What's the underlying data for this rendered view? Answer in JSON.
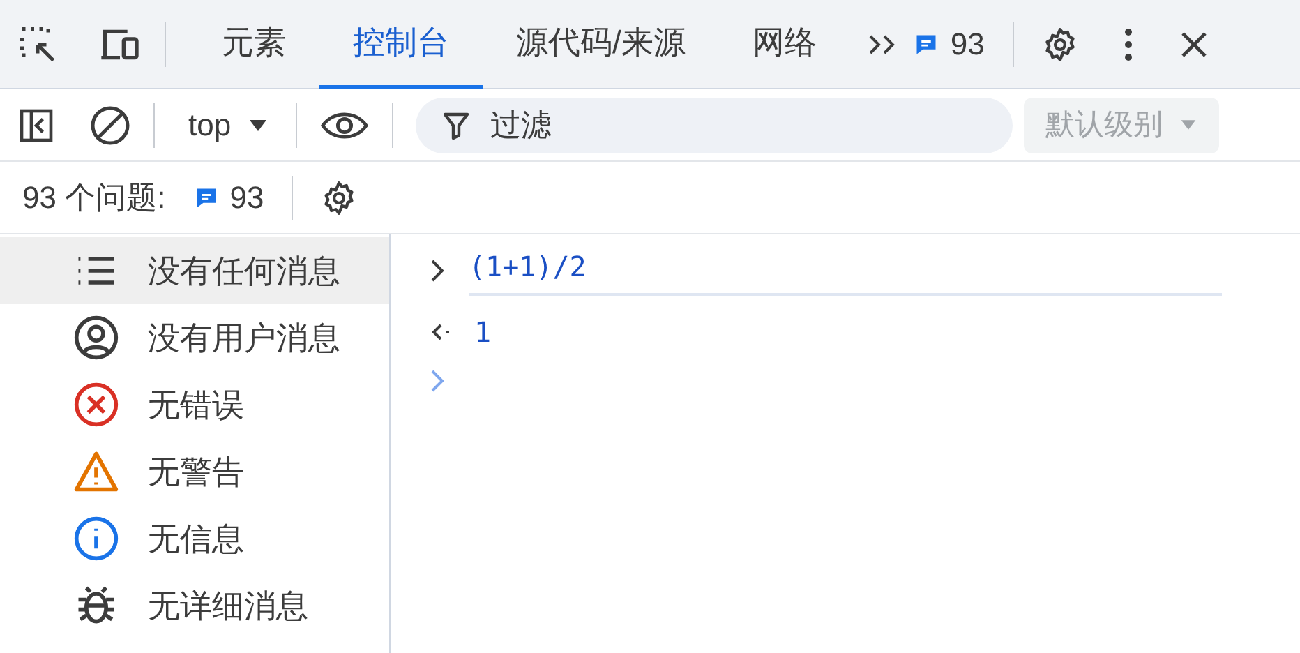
{
  "tabs": [
    {
      "label": "元素",
      "selected": false
    },
    {
      "label": "控制台",
      "selected": true
    },
    {
      "label": "源代码/来源",
      "selected": false
    },
    {
      "label": "网络",
      "selected": false
    }
  ],
  "issues_badge": "93",
  "toolbar": {
    "context": "top",
    "filter_placeholder": "过滤",
    "levels": "默认级别"
  },
  "issues_bar": {
    "label": "93 个问题:",
    "count": "93"
  },
  "sidebar": {
    "items": [
      {
        "label": "没有任何消息",
        "kind": "list",
        "selected": true
      },
      {
        "label": "没有用户消息",
        "kind": "user",
        "selected": false
      },
      {
        "label": "无错误",
        "kind": "error",
        "selected": false
      },
      {
        "label": "无警告",
        "kind": "warning",
        "selected": false
      },
      {
        "label": "无信息",
        "kind": "info",
        "selected": false
      },
      {
        "label": "无详细消息",
        "kind": "verbose",
        "selected": false
      }
    ]
  },
  "console": {
    "lines": [
      {
        "kind": "input",
        "text": "(1+1)/2"
      },
      {
        "kind": "output",
        "text": "1"
      }
    ]
  }
}
